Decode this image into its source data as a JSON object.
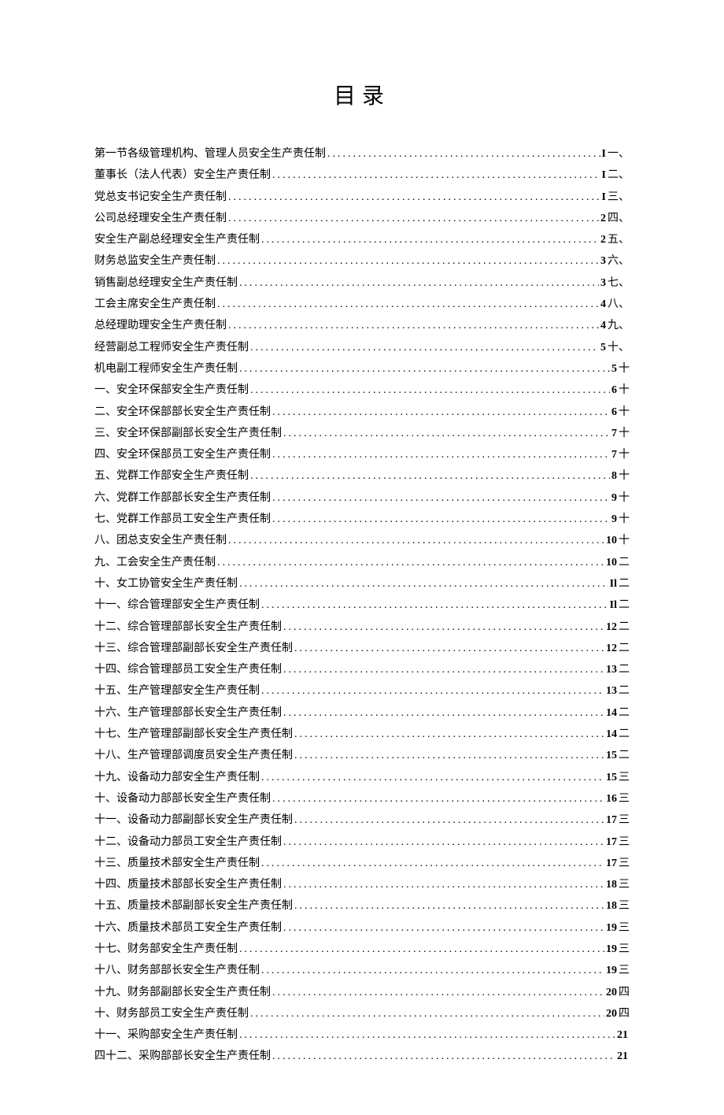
{
  "title": "目录",
  "toc": [
    {
      "label": "第一节各级管理机构、管理人员安全生产责任制",
      "page": "I",
      "tail": " 一、"
    },
    {
      "label": "董事长（法人代表）安全生产责任制",
      "page": "I",
      "tail": " 二、"
    },
    {
      "label": "党总支书记安全生产责任制",
      "page": "I",
      "tail": " 三、"
    },
    {
      "label": "公司总经理安全生产责任制",
      "page": "2",
      "tail": " 四、"
    },
    {
      "label": "安全生产副总经理安全生产责任制",
      "page": "2",
      "tail": " 五、"
    },
    {
      "label": "财务总监安全生产责任制",
      "page": "3",
      "tail": " 六、"
    },
    {
      "label": "销售副总经理安全生产责任制",
      "page": "3",
      "tail": " 七、"
    },
    {
      "label": "工会主席安全生产责任制",
      "page": "4",
      "tail": " 八、"
    },
    {
      "label": "总经理助理安全生产责任制",
      "page": "4",
      "tail": " 九、"
    },
    {
      "label": "经营副总工程师安全生产责任制",
      "page": "5",
      "tail": " 十、"
    },
    {
      "label": "机电副工程师安全生产责任制",
      "page": "5",
      "tail": " 十"
    },
    {
      "label": "一、安全环保部安全生产责任制",
      "page": "6",
      "tail": " 十"
    },
    {
      "label": "二、安全环保部部长安全生产责任制",
      "page": "6",
      "tail": " 十"
    },
    {
      "label": "三、安全环保部副部长安全生产责任制",
      "page": "7",
      "tail": " 十"
    },
    {
      "label": "四、安全环保部员工安全生产责任制",
      "page": "7",
      "tail": " 十"
    },
    {
      "label": "五、党群工作部安全生产责任制",
      "page": "8",
      "tail": " 十"
    },
    {
      "label": "六、党群工作部部长安全生产责任制",
      "page": "9",
      "tail": " 十"
    },
    {
      "label": "七、党群工作部员工安全生产责任制",
      "page": "9",
      "tail": " 十"
    },
    {
      "label": "八、团总支安全生产责任制",
      "page": "10",
      "tail": " 十"
    },
    {
      "label": "九、工会安全生产责任制",
      "page": "10",
      "tail": " 二"
    },
    {
      "label": "十、女工协管安全生产责任制",
      "page": "Il",
      "tail": " 二"
    },
    {
      "label": "十一、综合管理部安全生产责任制",
      "page": "Il",
      "tail": " 二"
    },
    {
      "label": "十二、综合管理部部长安全生产责任制",
      "page": "12",
      "tail": " 二"
    },
    {
      "label": "十三、综合管理部副部长安全生产责任制",
      "page": "12",
      "tail": " 二"
    },
    {
      "label": "十四、综合管理部员工安全生产责任制",
      "page": "13",
      "tail": " 二"
    },
    {
      "label": "十五、生产管理部安全生产责任制",
      "page": "13",
      "tail": " 二"
    },
    {
      "label": "十六、生产管理部部长安全生产责任制",
      "page": "14",
      "tail": " 二"
    },
    {
      "label": "十七、生产管理部副部长安全生产责任制",
      "page": "14",
      "tail": " 二"
    },
    {
      "label": "十八、生产管理部调度员安全生产责任制",
      "page": "15",
      "tail": " 二"
    },
    {
      "label": "十九、设备动力部安全生产责任制",
      "page": "15",
      "tail": "三"
    },
    {
      "label": "十、设备动力部部长安全生产责任制",
      "page": "16",
      "tail": " 三"
    },
    {
      "label": "十一、设备动力部副部长安全生产责任制",
      "page": "17",
      "tail": "三"
    },
    {
      "label": "十二、设备动力部员工安全生产责任制",
      "page": "17",
      "tail": "三"
    },
    {
      "label": "十三、质量技术部安全生产责任制",
      "page": "17",
      "tail": "三"
    },
    {
      "label": "十四、质量技术部部长安全生产责任制",
      "page": "18",
      "tail": "三"
    },
    {
      "label": "十五、质量技术部副部长安全生产责任制",
      "page": "18",
      "tail": " 三"
    },
    {
      "label": "十六、质量技术部员工安全生产责任制",
      "page": "19",
      "tail": "三"
    },
    {
      "label": "十七、财务部安全生产责任制",
      "page": "19",
      "tail": " 三"
    },
    {
      "label": "十八、财务部部长安全生产责任制",
      "page": "19",
      "tail": " 三"
    },
    {
      "label": "十九、财务部副部长安全生产责任制",
      "page": "20",
      "tail": " 四"
    },
    {
      "label": "十、财务部员工安全生产责任制",
      "page": "20",
      "tail": " 四"
    },
    {
      "label": "十一、采购部安全生产责任制",
      "page": "21",
      "tail": ""
    },
    {
      "label": "四十二、采购部部长安全生产责任制",
      "page": "21",
      "tail": ""
    }
  ]
}
